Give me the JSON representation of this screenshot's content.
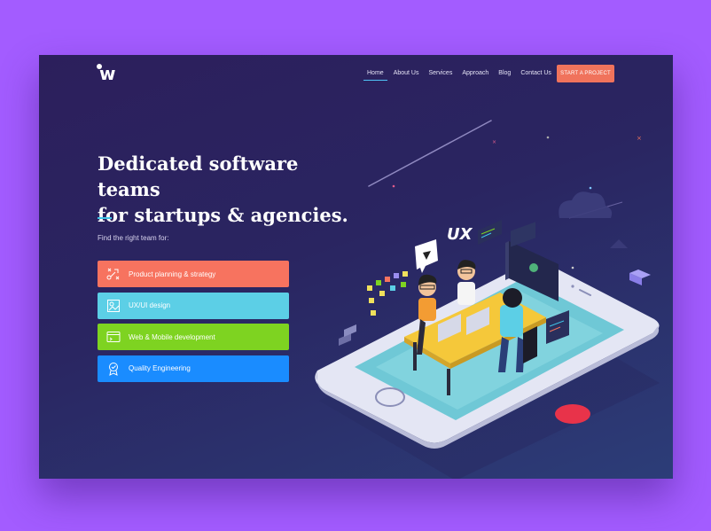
{
  "logo": {
    "text": "w"
  },
  "nav": {
    "items": [
      {
        "label": "Home",
        "active": true
      },
      {
        "label": "About Us",
        "active": false
      },
      {
        "label": "Services",
        "active": false
      },
      {
        "label": "Approach",
        "active": false
      },
      {
        "label": "Blog",
        "active": false
      },
      {
        "label": "Contact Us",
        "active": false
      }
    ],
    "cta_label": "START A PROJECT"
  },
  "hero": {
    "headline_line1": "Dedicated software teams",
    "headline_line2": "for startups & agencies.",
    "subtitle": "Find the right team for:"
  },
  "services": [
    {
      "label": "Product planning & strategy",
      "color": "#f7735f",
      "icon": "strategy-icon"
    },
    {
      "label": "UX/UI design",
      "color": "#5ccfe6",
      "icon": "design-icon"
    },
    {
      "label": "Web & Mobile development",
      "color": "#7ed321",
      "icon": "browser-icon"
    },
    {
      "label": "Quality Engineering",
      "color": "#1a8cff",
      "icon": "badge-icon"
    }
  ],
  "illustration": {
    "ux_label": "UX"
  },
  "colors": {
    "background": "#a35cff",
    "accent": "#3fc5e8",
    "cta": "#f0735c"
  }
}
